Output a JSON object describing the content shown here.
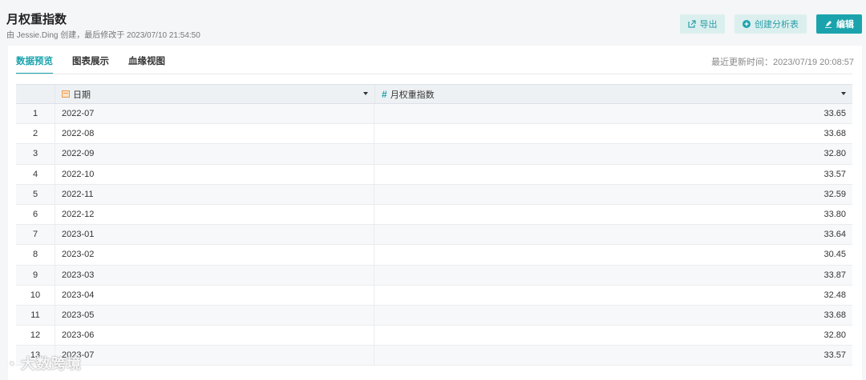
{
  "header": {
    "title": "月权重指数",
    "meta": "由 Jessie.Ding 创建，最后修改于 2023/07/10 21:54:50",
    "buttons": {
      "export": "导出",
      "create_analysis": "创建分析表",
      "edit": "编辑"
    }
  },
  "tabs": [
    {
      "label": "数据预览",
      "active": true
    },
    {
      "label": "图表展示",
      "active": false
    },
    {
      "label": "血缘视图",
      "active": false
    }
  ],
  "updated": "最近更新时间：2023/07/19 20:08:57",
  "table": {
    "columns": [
      {
        "label": "日期",
        "type_icon": "date-icon"
      },
      {
        "label": "月权重指数",
        "type_icon": "number-icon"
      }
    ],
    "rows": [
      {
        "idx": "1",
        "date": "2022-07",
        "value": "33.65"
      },
      {
        "idx": "2",
        "date": "2022-08",
        "value": "33.68"
      },
      {
        "idx": "3",
        "date": "2022-09",
        "value": "32.80"
      },
      {
        "idx": "4",
        "date": "2022-10",
        "value": "33.57"
      },
      {
        "idx": "5",
        "date": "2022-11",
        "value": "32.59"
      },
      {
        "idx": "6",
        "date": "2022-12",
        "value": "33.80"
      },
      {
        "idx": "7",
        "date": "2023-01",
        "value": "33.64"
      },
      {
        "idx": "8",
        "date": "2023-02",
        "value": "30.45"
      },
      {
        "idx": "9",
        "date": "2023-03",
        "value": "33.87"
      },
      {
        "idx": "10",
        "date": "2023-04",
        "value": "32.48"
      },
      {
        "idx": "11",
        "date": "2023-05",
        "value": "33.68"
      },
      {
        "idx": "12",
        "date": "2023-06",
        "value": "32.80"
      },
      {
        "idx": "13",
        "date": "2023-07",
        "value": "33.57"
      }
    ]
  },
  "watermark": "大数跨境",
  "colors": {
    "accent": "#1aa3ad",
    "light_button": "#dcefef"
  }
}
